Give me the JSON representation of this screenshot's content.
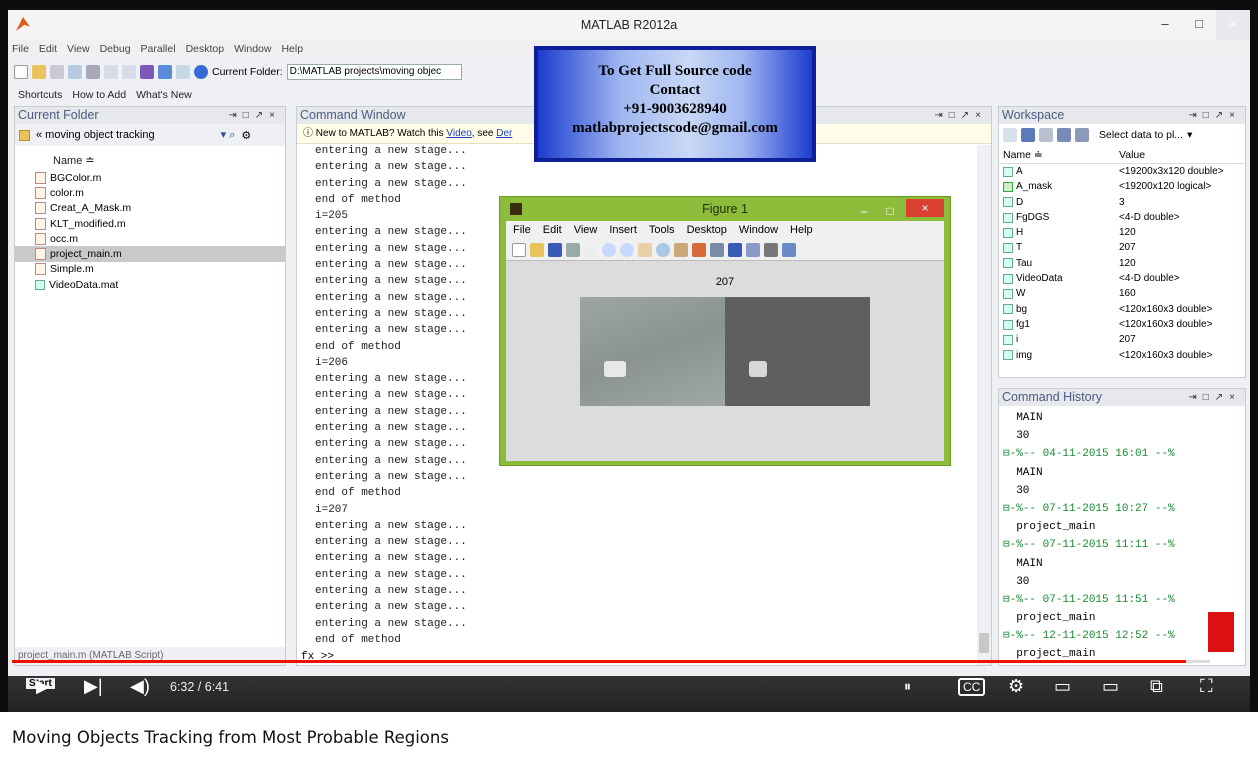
{
  "window": {
    "title": "MATLAB  R2012a",
    "min": "–",
    "max": "□",
    "close": "×"
  },
  "menu": [
    "File",
    "Edit",
    "View",
    "Debug",
    "Parallel",
    "Desktop",
    "Window",
    "Help"
  ],
  "toolbar": {
    "current_folder_label": "Current Folder:",
    "current_folder_value": "D:\\MATLAB projects\\moving objec"
  },
  "shortcuts": [
    "Shortcuts",
    "How to Add",
    "What's New"
  ],
  "current_folder": {
    "title": "Current Folder",
    "path": "« moving object tracking",
    "col_name": "Name ≐",
    "files": [
      {
        "name": "BGColor.m"
      },
      {
        "name": "color.m"
      },
      {
        "name": "Creat_A_Mask.m"
      },
      {
        "name": "KLT_modified.m"
      },
      {
        "name": "occ.m"
      },
      {
        "name": "project_main.m",
        "selected": true
      },
      {
        "name": "Simple.m"
      },
      {
        "name": "VideoData.mat"
      }
    ],
    "status": "project_main.m (MATLAB Script)"
  },
  "command_window": {
    "title": "Command Window",
    "tip_text": "New to MATLAB? Watch this ",
    "tip_link1": "Video",
    "tip_mid": ", see ",
    "tip_link2": "Der",
    "lines": [
      "entering a new stage...",
      "entering a new stage...",
      "entering a new stage...",
      "end of method",
      "i=205",
      "entering a new stage...",
      "entering a new stage...",
      "entering a new stage...",
      "entering a new stage...",
      "entering a new stage...",
      "entering a new stage...",
      "entering a new stage...",
      "end of method",
      "i=206",
      "entering a new stage...",
      "entering a new stage...",
      "entering a new stage...",
      "entering a new stage...",
      "entering a new stage...",
      "entering a new stage...",
      "entering a new stage...",
      "end of method",
      "i=207",
      "entering a new stage...",
      "entering a new stage...",
      "entering a new stage...",
      "entering a new stage...",
      "entering a new stage...",
      "entering a new stage...",
      "entering a new stage...",
      "end of method"
    ],
    "prompt": "fx >>"
  },
  "workspace": {
    "title": "Workspace",
    "select_btn": "Select data to pl...",
    "col_name": "Name ≐",
    "col_value": "Value",
    "rows": [
      {
        "name": "A",
        "value": "<19200x3x120 double>"
      },
      {
        "name": "A_mask",
        "value": "<19200x120 logical>",
        "check": true
      },
      {
        "name": "D",
        "value": "3"
      },
      {
        "name": "FgDGS",
        "value": "<4-D double>"
      },
      {
        "name": "H",
        "value": "120"
      },
      {
        "name": "T",
        "value": "207"
      },
      {
        "name": "Tau",
        "value": "120"
      },
      {
        "name": "VideoData",
        "value": "<4-D double>"
      },
      {
        "name": "W",
        "value": "160"
      },
      {
        "name": "bg",
        "value": "<120x160x3 double>"
      },
      {
        "name": "fg1",
        "value": "<120x160x3 double>"
      },
      {
        "name": "i",
        "value": "207"
      },
      {
        "name": "img",
        "value": "<120x160x3 double>"
      }
    ]
  },
  "command_history": {
    "title": "Command History",
    "lines": [
      {
        "text": "  MAIN",
        "hdr": false
      },
      {
        "text": "  30",
        "hdr": false
      },
      {
        "text": "⊟-%-- 04-11-2015 16:01 --%",
        "hdr": true
      },
      {
        "text": "  MAIN",
        "hdr": false
      },
      {
        "text": "  30",
        "hdr": false
      },
      {
        "text": "⊟-%-- 07-11-2015 10:27 --%",
        "hdr": true
      },
      {
        "text": "  project_main",
        "hdr": false
      },
      {
        "text": "⊟-%-- 07-11-2015 11:11 --%",
        "hdr": true
      },
      {
        "text": "  MAIN",
        "hdr": false
      },
      {
        "text": "  30",
        "hdr": false
      },
      {
        "text": "⊟-%-- 07-11-2015 11:51 --%",
        "hdr": true
      },
      {
        "text": "  project_main",
        "hdr": false
      },
      {
        "text": "⊟-%-- 12-11-2015 12:52 --%",
        "hdr": true
      },
      {
        "text": "  project_main",
        "hdr": false
      }
    ]
  },
  "figure": {
    "title": "Figure 1",
    "menu": [
      "File",
      "Edit",
      "View",
      "Insert",
      "Tools",
      "Desktop",
      "Window",
      "Help"
    ],
    "frame_number": "207"
  },
  "ad": {
    "line1": "To Get Full Source code",
    "line2": "Contact",
    "line3": "+91-9003628940",
    "line4": "matlabprojectscode@gmail.com"
  },
  "player": {
    "time": "6:32 / 6:41",
    "start": "Start",
    "progress": 0.98
  },
  "video_title": "Moving Objects Tracking from Most Probable Regions"
}
